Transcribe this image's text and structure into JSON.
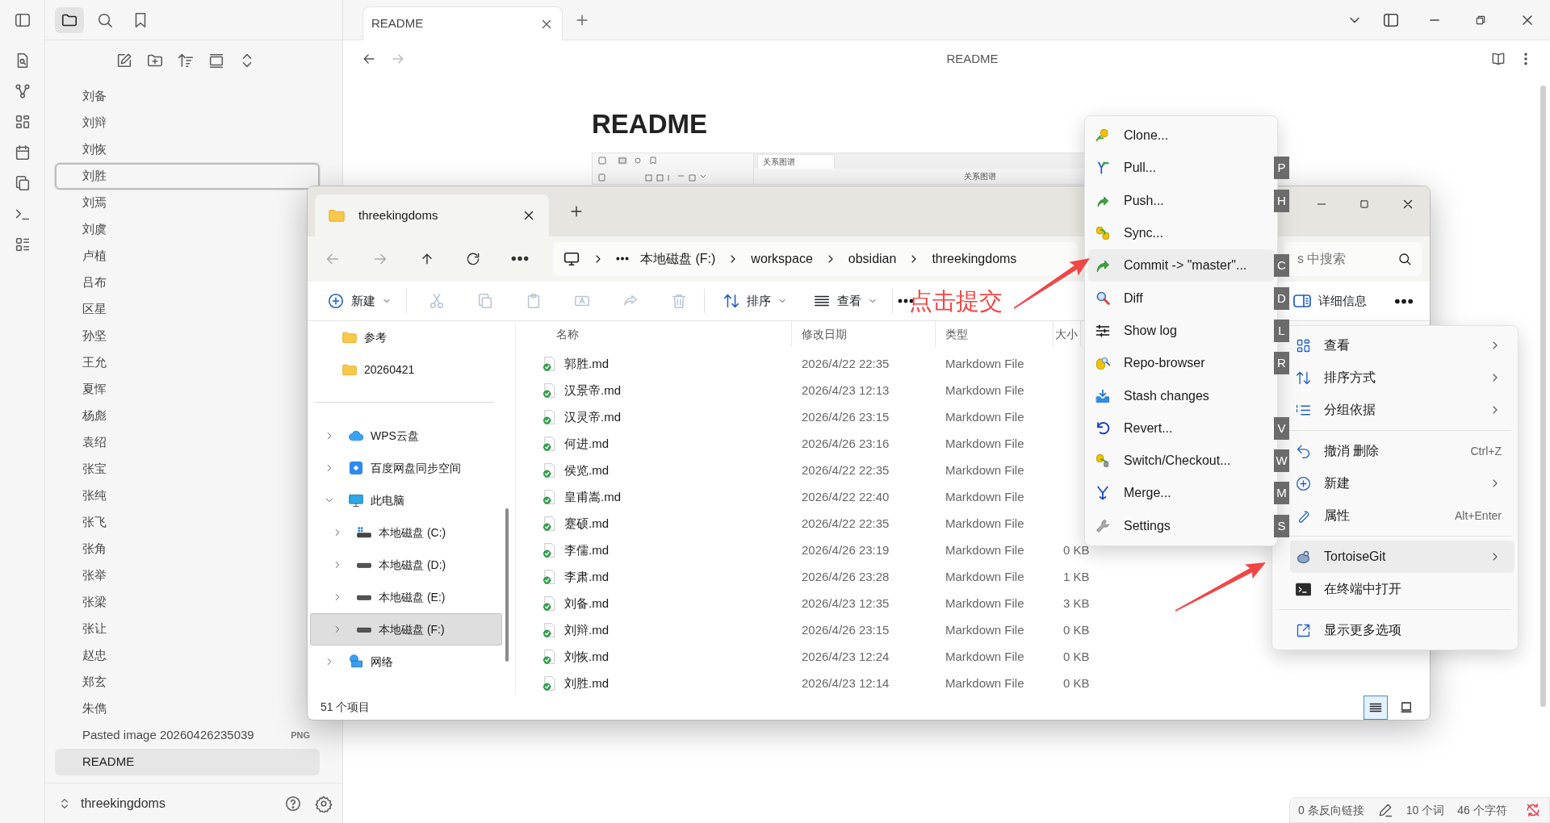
{
  "sidebar": {
    "items": [
      {
        "label": "刘备",
        "selected": false,
        "focused": false
      },
      {
        "label": "刘辩",
        "selected": false,
        "focused": false
      },
      {
        "label": "刘恢",
        "selected": false,
        "focused": false
      },
      {
        "label": "刘胜",
        "selected": false,
        "focused": true
      },
      {
        "label": "刘焉",
        "selected": false,
        "focused": false
      },
      {
        "label": "刘虞",
        "selected": false,
        "focused": false
      },
      {
        "label": "卢植",
        "selected": false,
        "focused": false
      },
      {
        "label": "吕布",
        "selected": false,
        "focused": false
      },
      {
        "label": "区星",
        "selected": false,
        "focused": false
      },
      {
        "label": "孙坚",
        "selected": false,
        "focused": false
      },
      {
        "label": "王允",
        "selected": false,
        "focused": false
      },
      {
        "label": "夏恽",
        "selected": false,
        "focused": false
      },
      {
        "label": "杨彪",
        "selected": false,
        "focused": false
      },
      {
        "label": "袁绍",
        "selected": false,
        "focused": false
      },
      {
        "label": "张宝",
        "selected": false,
        "focused": false
      },
      {
        "label": "张纯",
        "selected": false,
        "focused": false
      },
      {
        "label": "张飞",
        "selected": false,
        "focused": false
      },
      {
        "label": "张角",
        "selected": false,
        "focused": false
      },
      {
        "label": "张举",
        "selected": false,
        "focused": false
      },
      {
        "label": "张梁",
        "selected": false,
        "focused": false
      },
      {
        "label": "张让",
        "selected": false,
        "focused": false
      },
      {
        "label": "赵忠",
        "selected": false,
        "focused": false
      },
      {
        "label": "郑玄",
        "selected": false,
        "focused": false
      },
      {
        "label": "朱儁",
        "selected": false,
        "focused": false
      },
      {
        "label": "Pasted image 20260426235039",
        "badge": "PNG",
        "selected": false,
        "focused": false
      },
      {
        "label": "README",
        "selected": true,
        "focused": false
      }
    ],
    "vault": "threekingdoms",
    "tabs": [
      {
        "selected": true
      },
      {
        "selected": false
      },
      {
        "selected": false
      }
    ]
  },
  "editor": {
    "tab": "README",
    "view_title": "README",
    "heading": "README",
    "embedded_screenshot": {
      "tab": "关系图谱",
      "title": "关系图谱"
    }
  },
  "explorer": {
    "tab": "threekingdoms",
    "breadcrumb": [
      "本地磁盘 (F:)",
      "workspace",
      "obsidian",
      "threekingdoms"
    ],
    "search_placeholder": "s 中搜索",
    "commands": {
      "new": "新建",
      "sort": "排序",
      "view": "查看",
      "details": "详细信息"
    },
    "quick_access": [
      {
        "label": "参考",
        "selected": false
      },
      {
        "label": "20260421",
        "selected": false
      }
    ],
    "tree": [
      {
        "label": "WPS云盘",
        "kind": "cloud",
        "expanded": false,
        "selected": false
      },
      {
        "label": "百度网盘同步空间",
        "kind": "sync",
        "expanded": false,
        "selected": false
      },
      {
        "label": "此电脑",
        "kind": "pc",
        "expanded": true,
        "selected": false,
        "children": [
          {
            "label": "本地磁盘 (C:)",
            "kind": "system-drive",
            "expanded": false,
            "selected": false
          },
          {
            "label": "本地磁盘 (D:)",
            "kind": "drive",
            "expanded": false,
            "selected": false
          },
          {
            "label": "本地磁盘 (E:)",
            "kind": "drive",
            "expanded": false,
            "selected": false
          },
          {
            "label": "本地磁盘 (F:)",
            "kind": "drive",
            "expanded": false,
            "selected": true
          }
        ]
      },
      {
        "label": "网络",
        "kind": "network",
        "expanded": false,
        "selected": false
      }
    ],
    "columns": [
      "名称",
      "修改日期",
      "类型",
      "大小"
    ],
    "rows": [
      {
        "name": "郭胜.md",
        "modified": "2026/4/22 22:35",
        "type": "Markdown File"
      },
      {
        "name": "汉景帝.md",
        "modified": "2026/4/23 12:13",
        "type": "Markdown File"
      },
      {
        "name": "汉灵帝.md",
        "modified": "2026/4/26 23:15",
        "type": "Markdown File"
      },
      {
        "name": "何进.md",
        "modified": "2026/4/26 23:16",
        "type": "Markdown File"
      },
      {
        "name": "侯览.md",
        "modified": "2026/4/22 22:35",
        "type": "Markdown File"
      },
      {
        "name": "皇甫嵩.md",
        "modified": "2026/4/22 22:40",
        "type": "Markdown File"
      },
      {
        "name": "蹇硕.md",
        "modified": "2026/4/22 22:35",
        "type": "Markdown File"
      },
      {
        "name": "李儒.md",
        "modified": "2026/4/26 23:19",
        "type": "Markdown File",
        "size": "0 KB"
      },
      {
        "name": "李肃.md",
        "modified": "2026/4/26 23:28",
        "type": "Markdown File",
        "size": "1 KB"
      },
      {
        "name": "刘备.md",
        "modified": "2026/4/23 12:35",
        "type": "Markdown File",
        "size": "3 KB"
      },
      {
        "name": "刘辩.md",
        "modified": "2026/4/26 23:15",
        "type": "Markdown File",
        "size": "0 KB"
      },
      {
        "name": "刘恢.md",
        "modified": "2026/4/23 12:24",
        "type": "Markdown File",
        "size": "0 KB"
      },
      {
        "name": "刘胜.md",
        "modified": "2026/4/23 12:14",
        "type": "Markdown File",
        "size": "0 KB"
      }
    ],
    "status": "51 个项目"
  },
  "tortoise_menu": [
    {
      "label": "Clone...",
      "selected": false
    },
    {
      "label": "Pull...",
      "key": "P",
      "selected": false
    },
    {
      "label": "Push...",
      "key": "H",
      "selected": false
    },
    {
      "label": "Sync...",
      "selected": false
    },
    {
      "label": "Commit -> \"master\"...",
      "key": "C",
      "selected": true
    },
    {
      "label": "Diff",
      "key": "D",
      "selected": false
    },
    {
      "label": "Show log",
      "key": "L",
      "selected": false
    },
    {
      "label": "Repo-browser",
      "key": "R",
      "selected": false
    },
    {
      "label": "Stash changes",
      "selected": false
    },
    {
      "label": "Revert...",
      "key": "V",
      "selected": false
    },
    {
      "label": "Switch/Checkout...",
      "key": "W",
      "selected": false
    },
    {
      "label": "Merge...",
      "key": "M",
      "selected": false
    },
    {
      "label": "Settings",
      "key": "S",
      "selected": false
    }
  ],
  "context_menu": {
    "groups": [
      [
        {
          "label": "查看",
          "submenu": true,
          "selected": false
        },
        {
          "label": "排序方式",
          "submenu": true,
          "selected": false
        },
        {
          "label": "分组依据",
          "submenu": true,
          "selected": false
        }
      ],
      [
        {
          "label": "撤消 删除",
          "shortcut": "Ctrl+Z",
          "submenu": false,
          "selected": false
        },
        {
          "label": "新建",
          "submenu": true,
          "selected": false
        },
        {
          "label": "属性",
          "shortcut": "Alt+Enter",
          "submenu": false,
          "selected": false
        }
      ],
      [
        {
          "label": "TortoiseGit",
          "submenu": true,
          "selected": true
        },
        {
          "label": "在终端中打开",
          "submenu": false,
          "selected": false
        }
      ],
      [
        {
          "label": "显示更多选项",
          "submenu": false,
          "selected": false
        }
      ]
    ]
  },
  "annotation": {
    "text": "点击提交"
  },
  "status_bar": {
    "backlinks": "0 条反向链接",
    "words": "10 个词",
    "chars": "46 个字符"
  }
}
